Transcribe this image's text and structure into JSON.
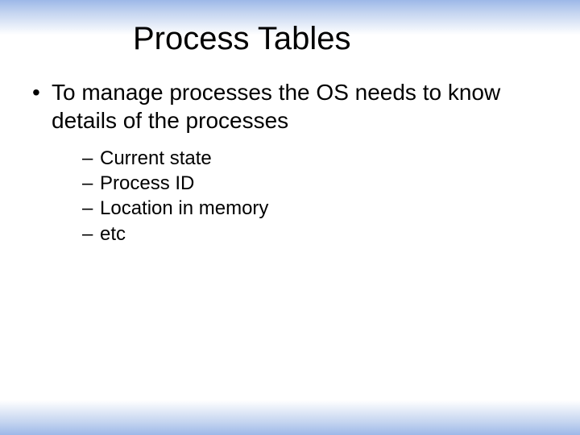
{
  "title": "Process Tables",
  "bullet": {
    "marker": "•",
    "text": "To manage processes the OS needs to know details of the processes"
  },
  "subitems": [
    {
      "dash": "–",
      "text": "Current state"
    },
    {
      "dash": "–",
      "text": "Process ID"
    },
    {
      "dash": "–",
      "text": "Location in memory"
    },
    {
      "dash": "–",
      "text": "etc"
    }
  ]
}
